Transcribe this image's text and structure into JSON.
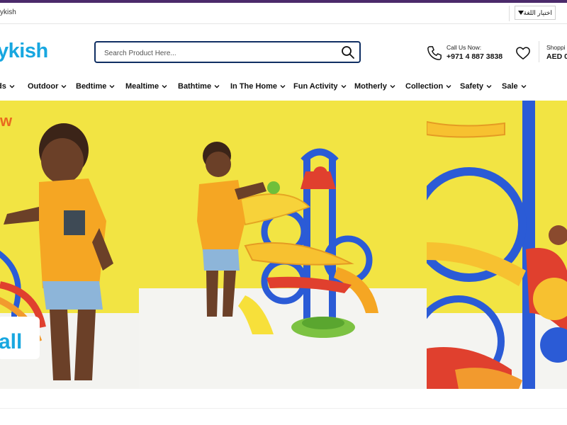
{
  "topbar": {
    "left_text": "ykish",
    "language_label": "اختيار اللغة"
  },
  "header": {
    "logo_text": "ykish",
    "search": {
      "placeholder": "Search Product Here..."
    },
    "call": {
      "label": "Call Us Now:",
      "number": "+971 4 887 3838"
    },
    "cart": {
      "label": "Shoppi",
      "total": "AED 0."
    }
  },
  "nav": {
    "items": [
      {
        "label": "ds"
      },
      {
        "label": "Outdoor"
      },
      {
        "label": "Bedtime"
      },
      {
        "label": "Mealtime"
      },
      {
        "label": "Bathtime"
      },
      {
        "label": "In The Home"
      },
      {
        "label": "Fun Activity"
      },
      {
        "label": "Motherly"
      },
      {
        "label": "Collection"
      },
      {
        "label": "Safety"
      },
      {
        "label": "Sale"
      }
    ]
  },
  "hero": {
    "badge_text": "all"
  },
  "colors": {
    "accent": "#4b2a6b",
    "logo": "#18a7e0",
    "search_border": "#102f63",
    "hero_yellow": "#f2e443",
    "toy_blue": "#2b5bd6",
    "toy_red": "#e0402e",
    "toy_orange": "#f29a2e"
  }
}
